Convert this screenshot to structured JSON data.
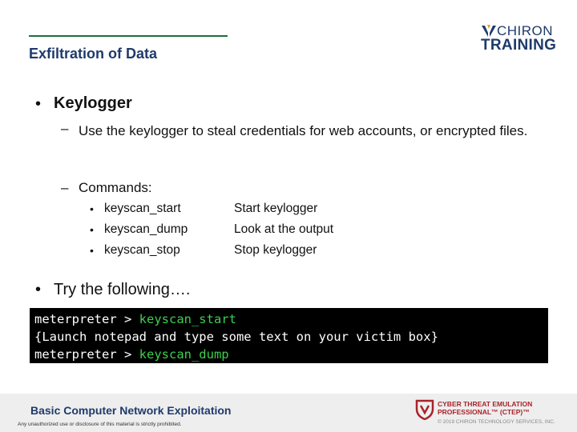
{
  "header": {
    "title": "Exfiltration of Data",
    "logo": {
      "top": "CHIRON",
      "bottom": "TRAINING"
    }
  },
  "content": {
    "bullet1": {
      "marker": "•",
      "label": "Keylogger",
      "sub": [
        {
          "marker": "–",
          "text": "Use the keylogger to steal credentials for web accounts, or encrypted files."
        },
        {
          "marker": "–",
          "text": "Commands:"
        }
      ],
      "commands": [
        {
          "marker": "•",
          "name": "keyscan_start",
          "desc": "Start keylogger"
        },
        {
          "marker": "•",
          "name": "keyscan_dump",
          "desc": "Look at the output"
        },
        {
          "marker": "•",
          "name": "keyscan_stop",
          "desc": "Stop keylogger"
        }
      ]
    },
    "bullet2": {
      "marker": "•",
      "label": "Try the following…."
    },
    "code": [
      {
        "prompt": "meterpreter > ",
        "cmd": "keyscan_start"
      },
      {
        "text": "{Launch notepad and type some text on your victim box}"
      },
      {
        "prompt": "meterpreter > ",
        "cmd": "keyscan_dump"
      }
    ]
  },
  "footer": {
    "course": "Basic Computer Network Exploitation",
    "notice": "Any unauthorized use or disclosure of this material is strictly prohibited.",
    "badge_line1": "CYBER THREAT EMULATION",
    "badge_line2": "PROFESSIONAL™ (CTEP)™",
    "copyright": "© 2019 CHIRON TECHNOLOGY SERVICES, INC."
  },
  "colors": {
    "title": "#1f3a6b",
    "rule": "#1f6e3a",
    "code_bg": "#000000",
    "code_cmd": "#3ccf4e",
    "badge": "#a8232a"
  }
}
